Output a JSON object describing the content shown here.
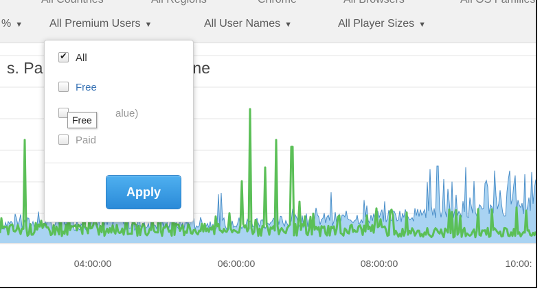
{
  "top_strip": [
    "All Countries",
    "All Regions",
    "Chrome",
    "All Browsers",
    "All OS Families"
  ],
  "filters": [
    {
      "label": "%"
    },
    {
      "label": "All Premium Users"
    },
    {
      "label": "All User Names"
    },
    {
      "label": "All Player Sizes"
    }
  ],
  "chart": {
    "title_fragment_left": "s. Pa",
    "title_fragment_right": "ne"
  },
  "dropdown": {
    "options": [
      {
        "label": "All",
        "checked": true
      },
      {
        "label": "Free",
        "checked": false
      },
      {
        "label": "alue)",
        "checked": false
      },
      {
        "label": "Paid",
        "checked": false
      }
    ],
    "apply_label": "Apply",
    "tooltip": "Free"
  },
  "chart_data": {
    "type": "area",
    "x_ticks": [
      "04:00:00",
      "06:00:00",
      "08:00:00",
      "10:00:"
    ],
    "series": [
      {
        "color": "#5bbf57"
      },
      {
        "color": "#4a8ec8"
      }
    ]
  },
  "colors": {
    "green_series": "#5bbf57",
    "blue_series": "#4a8ec8",
    "blue_fill": "#a9d3f2",
    "apply_button": "#2a8ad8",
    "link_blue": "#3a74b5"
  }
}
